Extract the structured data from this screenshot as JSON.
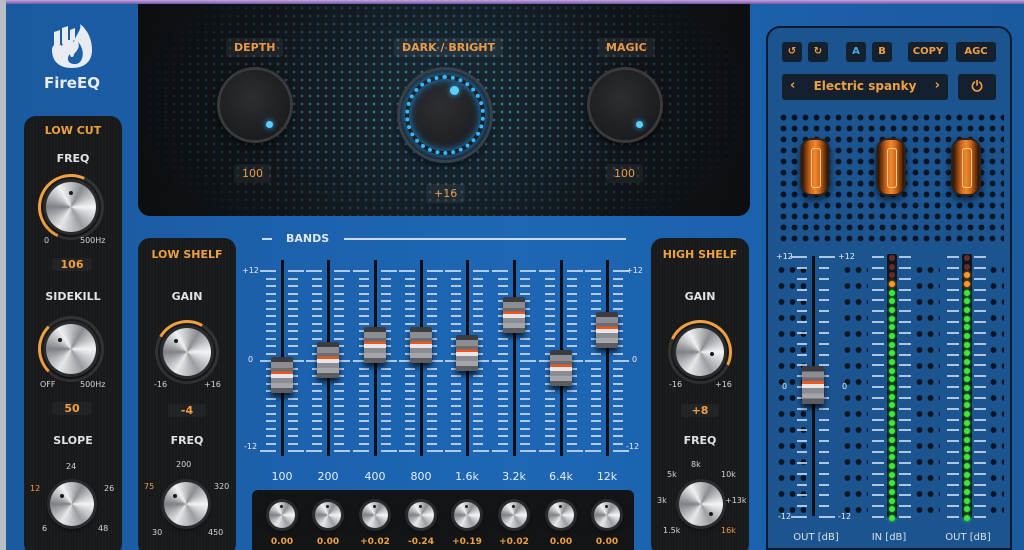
{
  "app": {
    "name": "FireEQ"
  },
  "macros": {
    "depth": {
      "label": "DEPTH",
      "value": "100"
    },
    "dark_bright": {
      "label": "DARK / BRIGHT",
      "value": "+16"
    },
    "magic": {
      "label": "MAGIC",
      "value": "100"
    }
  },
  "low_cut": {
    "title": "LOW CUT",
    "freq": {
      "label": "FREQ",
      "min": "0",
      "max": "500Hz",
      "value": "106"
    },
    "sidekill": {
      "label": "SIDEKILL",
      "min": "OFF",
      "max": "500Hz",
      "value": "50"
    },
    "slope": {
      "label": "SLOPE",
      "options": [
        "6",
        "12",
        "24",
        "26",
        "48"
      ],
      "selected": "12"
    }
  },
  "low_shelf": {
    "title": "LOW SHELF",
    "gain": {
      "label": "GAIN",
      "min": "-16",
      "max": "+16",
      "value": "-4"
    },
    "freq": {
      "label": "FREQ",
      "options": [
        "30",
        "75",
        "200",
        "320",
        "450"
      ],
      "selected": "75"
    }
  },
  "high_shelf": {
    "title": "HIGH SHELF",
    "gain": {
      "label": "GAIN",
      "min": "-16",
      "max": "+16",
      "value": "+8"
    },
    "freq": {
      "label": "FREQ",
      "options": [
        "1.5k",
        "3k",
        "5k",
        "8k",
        "10k",
        "+13k",
        "16k"
      ],
      "selected": "16k"
    }
  },
  "bands": {
    "title": "BANDS",
    "scale": {
      "top": "+12",
      "mid": "0",
      "bottom": "-12"
    },
    "range_db": [
      -12,
      12
    ],
    "items": [
      {
        "freq": "100",
        "gain_db": -2.0,
        "q": "0.00"
      },
      {
        "freq": "200",
        "gain_db": 0.0,
        "q": "0.00"
      },
      {
        "freq": "400",
        "gain_db": 2.0,
        "q": "+0.02"
      },
      {
        "freq": "800",
        "gain_db": 2.0,
        "q": "-0.24"
      },
      {
        "freq": "1.6k",
        "gain_db": 1.0,
        "q": "+0.19"
      },
      {
        "freq": "3.2k",
        "gain_db": 6.0,
        "q": "+0.02"
      },
      {
        "freq": "6.4k",
        "gain_db": -1.0,
        "q": "0.00"
      },
      {
        "freq": "12k",
        "gain_db": 4.0,
        "q": "0.00"
      }
    ]
  },
  "toolbar": {
    "undo_icon": "undo-icon",
    "redo_icon": "redo-icon",
    "a_label": "A",
    "b_label": "B",
    "copy_label": "COPY",
    "agc_label": "AGC",
    "preset_name": "Electric spanky",
    "prev_label": "‹",
    "next_label": "›",
    "power_icon": "power-icon"
  },
  "output": {
    "scale": {
      "top": "+12",
      "mid": "0",
      "bottom": "-12"
    },
    "out_gain_db": 0,
    "out_label": "OUT [dB]",
    "in_meter_label": "IN [dB]",
    "out_meter_label": "OUT [dB]",
    "in_level_fraction": 0.92,
    "out_level_fraction": 0.95
  },
  "colors": {
    "accent": "#f0a040",
    "background": "#1b5fa6",
    "led_blue": "#35b8ff"
  }
}
